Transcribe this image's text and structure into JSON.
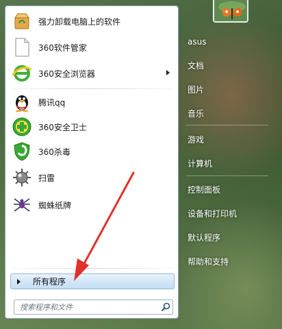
{
  "pinned_programs": [
    {
      "label": "强力卸载电脑上的软件",
      "icon": "uninstaller-box-icon",
      "has_submenu": false
    },
    {
      "label": "360软件管家",
      "icon": "blank-document-icon",
      "has_submenu": false
    },
    {
      "label": "360安全浏览器",
      "icon": "360-browser-icon",
      "has_submenu": true
    }
  ],
  "recent_programs": [
    {
      "label": "腾讯qq",
      "icon": "qq-penguin-icon"
    },
    {
      "label": "360安全卫士",
      "icon": "360-guard-icon"
    },
    {
      "label": "360杀毒",
      "icon": "360-antivirus-shield-icon"
    },
    {
      "label": "扫雷",
      "icon": "minesweeper-mine-icon"
    },
    {
      "label": "蜘蛛纸牌",
      "icon": "spider-solitaire-icon"
    }
  ],
  "all_programs_label": "所有程序",
  "search": {
    "placeholder": "搜索程序和文件"
  },
  "right_links": [
    {
      "label": "asus"
    },
    {
      "label": "文档"
    },
    {
      "label": "图片"
    },
    {
      "label": "音乐"
    },
    {
      "label": "游戏"
    },
    {
      "label": "计算机"
    },
    {
      "label": "控制面板"
    },
    {
      "label": "设备和打印机"
    },
    {
      "label": "默认程序"
    },
    {
      "label": "帮助和支持"
    }
  ],
  "colors": {
    "annotation_arrow": "#e0302a",
    "all_programs_highlight": "#d3e6f8"
  }
}
